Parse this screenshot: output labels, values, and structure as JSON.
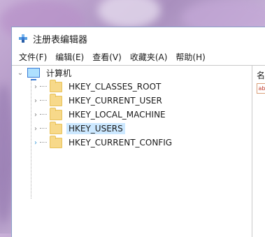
{
  "window": {
    "title": "注册表编辑器"
  },
  "menu": [
    {
      "label": "文件(F)"
    },
    {
      "label": "编辑(E)"
    },
    {
      "label": "查看(V)"
    },
    {
      "label": "收藏夹(A)"
    },
    {
      "label": "帮助(H)"
    }
  ],
  "tree": {
    "root": {
      "label": "计算机",
      "expanded": true,
      "chevron": "⌄"
    },
    "children": [
      {
        "label": "HKEY_CLASSES_ROOT",
        "chevron": "›",
        "selected": false
      },
      {
        "label": "HKEY_CURRENT_USER",
        "chevron": "›",
        "selected": false
      },
      {
        "label": "HKEY_LOCAL_MACHINE",
        "chevron": "›",
        "selected": false
      },
      {
        "label": "HKEY_USERS",
        "chevron": "›",
        "selected": true
      },
      {
        "label": "HKEY_CURRENT_CONFIG",
        "chevron": "›",
        "selected": false
      }
    ]
  },
  "right_pane": {
    "column_header": "名",
    "value_icon": "ab"
  },
  "colors": {
    "selection": "#cce8ff",
    "folder": "#f7d98a",
    "accent": "#3a7bd5"
  },
  "icons": {
    "title": "regedit-icon",
    "root": "computer-icon",
    "key": "folder-icon"
  }
}
